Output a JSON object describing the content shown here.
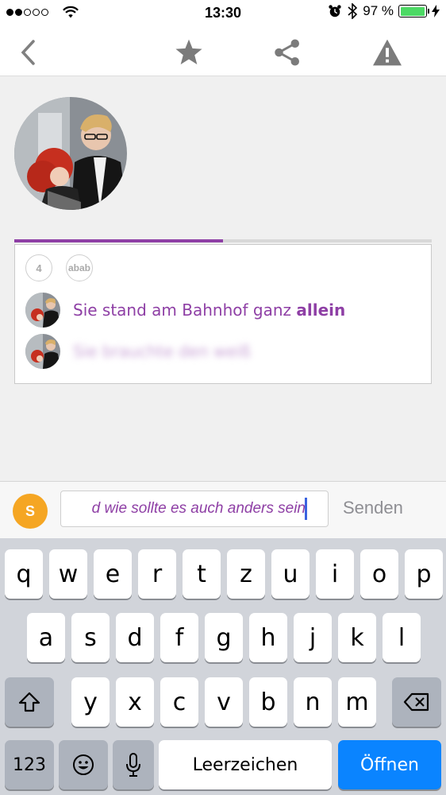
{
  "status_bar": {
    "time": "13:30",
    "battery_percent": "97 %",
    "battery_level": 0.97,
    "signal_bars": 2
  },
  "nav": {
    "icons": [
      "back-chevron-icon",
      "star-icon",
      "share-icon",
      "warning-icon"
    ]
  },
  "story": {
    "progress": 0.5,
    "count_badge": "4",
    "ab_badge": "abab",
    "messages": [
      {
        "prefix": "Sie stand am Bahnhof ganz ",
        "emphasis": "allein"
      },
      {
        "prefix": "Sie brauchte den weiß",
        "emphasis": ""
      }
    ]
  },
  "composer": {
    "user_initial": "S",
    "input_value": "d wie sollte es auch anders sein",
    "send_label": "Senden"
  },
  "keyboard": {
    "row1": [
      "q",
      "w",
      "e",
      "r",
      "t",
      "z",
      "u",
      "i",
      "o",
      "p"
    ],
    "row2": [
      "a",
      "s",
      "d",
      "f",
      "g",
      "h",
      "j",
      "k",
      "l"
    ],
    "row3": [
      "y",
      "x",
      "c",
      "v",
      "b",
      "n",
      "m"
    ],
    "numbers_label": "123",
    "space_label": "Leerzeichen",
    "return_label": "Öffnen"
  },
  "colors": {
    "accent": "#8e3fa5",
    "user_chip": "#f5a623",
    "return_key": "#0a84ff"
  }
}
